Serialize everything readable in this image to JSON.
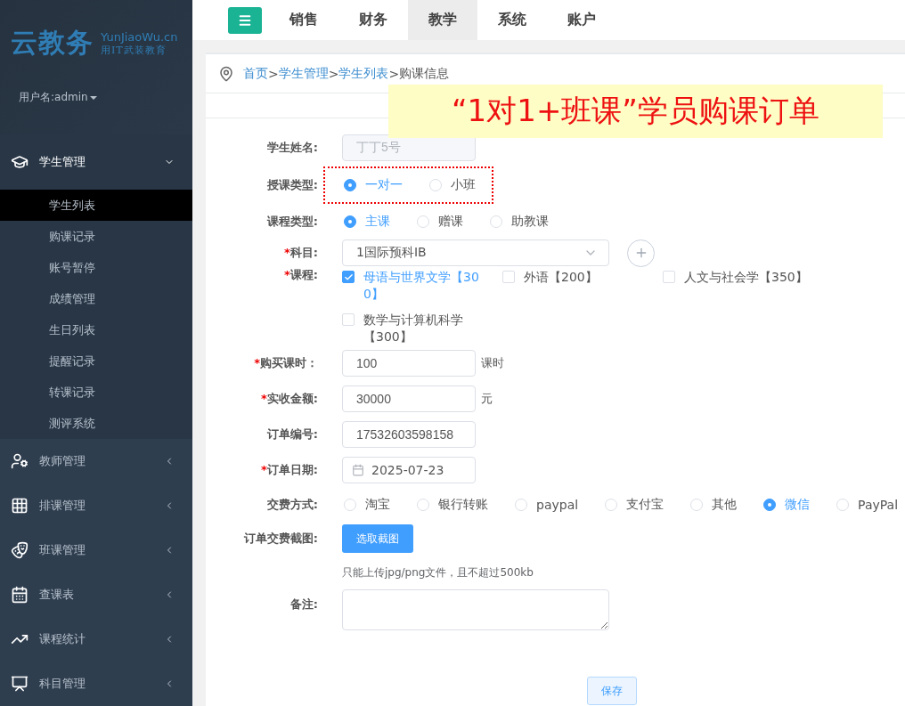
{
  "sidebar": {
    "logo": {
      "title": "云教务",
      "domain": "YunJiaoWu.cn",
      "slogan": "用IT武装教育"
    },
    "user": "用户名:admin",
    "menu": [
      {
        "label": "学生管理",
        "expanded": true,
        "children": [
          {
            "label": "学生列表",
            "selected": true
          },
          {
            "label": "购课记录",
            "selected": false
          },
          {
            "label": "账号暂停",
            "selected": false
          },
          {
            "label": "成绩管理",
            "selected": false
          },
          {
            "label": "生日列表",
            "selected": false
          },
          {
            "label": "提醒记录",
            "selected": false
          },
          {
            "label": "转课记录",
            "selected": false
          },
          {
            "label": "测评系统",
            "selected": false
          }
        ]
      },
      {
        "label": "教师管理",
        "expanded": false
      },
      {
        "label": "排课管理",
        "expanded": false
      },
      {
        "label": "班课管理",
        "expanded": false
      },
      {
        "label": "查课表",
        "expanded": false
      },
      {
        "label": "课程统计",
        "expanded": false
      },
      {
        "label": "科目管理",
        "expanded": false
      }
    ]
  },
  "top_nav": {
    "tabs": [
      {
        "label": "销售",
        "selected": false
      },
      {
        "label": "财务",
        "selected": false
      },
      {
        "label": "教学",
        "selected": true
      },
      {
        "label": "系统",
        "selected": false
      },
      {
        "label": "账户",
        "selected": false
      }
    ]
  },
  "breadcrumb": {
    "separator": ">",
    "items": [
      {
        "label": "首页",
        "link": true
      },
      {
        "label": "学生管理",
        "link": true
      },
      {
        "label": "学生列表",
        "link": true
      },
      {
        "label": "购课信息",
        "link": false
      }
    ]
  },
  "banner": "“1对1+班课”学员购课订单",
  "form": {
    "fields": [
      {
        "kind": "text",
        "label": "学生姓名:",
        "value": "丁丁5号",
        "disabled": true
      },
      {
        "kind": "radio",
        "label": "授课类型:",
        "highlighted": true,
        "options": [
          {
            "label": "一对一",
            "selected": true
          },
          {
            "label": "小班",
            "selected": false
          }
        ]
      },
      {
        "kind": "radio",
        "label": "课程类型:",
        "options": [
          {
            "label": "主课",
            "selected": true
          },
          {
            "label": "赠课",
            "selected": false
          },
          {
            "label": "助教课",
            "selected": false
          }
        ]
      },
      {
        "kind": "select",
        "label": "科目:",
        "required_mark": "*",
        "value": "1国际预科IB"
      },
      {
        "kind": "checkbox",
        "label": "课程:",
        "required_mark": "*",
        "options": [
          {
            "label": "母语与世界文学【300】",
            "checked": true
          },
          {
            "label": "外语【200】",
            "checked": false
          },
          {
            "label": "人文与社会学【350】",
            "checked": false
          },
          {
            "label": "数学与计算机科学【300】",
            "checked": false
          }
        ]
      },
      {
        "kind": "text",
        "label": "购买课时：",
        "required_mark": "*",
        "value": "100",
        "unit": "课时"
      },
      {
        "kind": "text",
        "label": "实收金额:",
        "required_mark": "*",
        "value": "30000",
        "unit": "元"
      },
      {
        "kind": "text",
        "label": "订单编号:",
        "value": "17532603598158"
      },
      {
        "kind": "date",
        "label": "订单日期:",
        "required_mark": "*",
        "value": "2025-07-23"
      },
      {
        "kind": "radio",
        "label": "交费方式:",
        "options": [
          {
            "label": "淘宝",
            "selected": false
          },
          {
            "label": "银行转账",
            "selected": false
          },
          {
            "label": "paypal",
            "selected": false
          },
          {
            "label": "支付宝",
            "selected": false
          },
          {
            "label": "其他",
            "selected": false
          },
          {
            "label": "微信",
            "selected": true
          },
          {
            "label": "PayPal",
            "selected": false
          }
        ]
      },
      {
        "kind": "upload",
        "label": "订单交费截图:",
        "button": "选取截图",
        "hint": "只能上传jpg/png文件，且不超过500kb"
      },
      {
        "kind": "textarea",
        "label": "备注:"
      }
    ],
    "submit": "保存"
  }
}
